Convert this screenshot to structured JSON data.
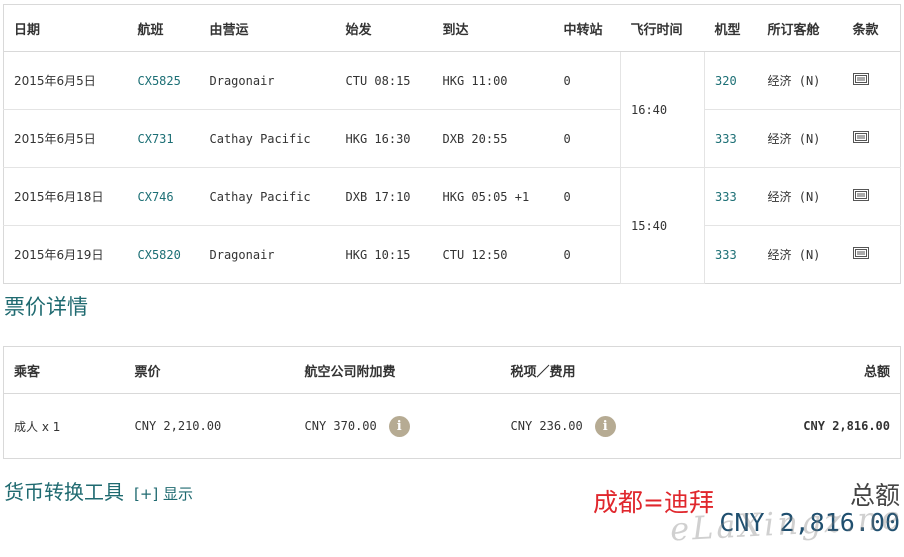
{
  "flights": {
    "headers": [
      "日期",
      "航班",
      "由营运",
      "始发",
      "到达",
      "中转站",
      "飞行时间",
      "机型",
      "所订客舱",
      "条款"
    ],
    "rows": [
      {
        "date": "2015年6月5日",
        "flight": "CX5825",
        "operator": "Dragonair",
        "depart": "CTU 08:15",
        "arrive": "HKG 11:00",
        "stops": "0",
        "aircraft": "320",
        "cabin": "经济 (N)"
      },
      {
        "date": "2015年6月5日",
        "flight": "CX731",
        "operator": "Cathay Pacific",
        "depart": "HKG 16:30",
        "arrive": "DXB 20:55",
        "stops": "0",
        "aircraft": "333",
        "cabin": "经济 (N)"
      },
      {
        "date": "2015年6月18日",
        "flight": "CX746",
        "operator": "Cathay Pacific",
        "depart": "DXB 17:10",
        "arrive": "HKG 05:05 +1",
        "stops": "0",
        "aircraft": "333",
        "cabin": "经济 (N)"
      },
      {
        "date": "2015年6月19日",
        "flight": "CX5820",
        "operator": "Dragonair",
        "depart": "HKG 10:15",
        "arrive": "CTU 12:50",
        "stops": "0",
        "aircraft": "333",
        "cabin": "经济 (N)"
      }
    ],
    "durations": [
      "16:40",
      "15:40"
    ],
    "terms_icon": "document-icon"
  },
  "fare_details": {
    "title": "票价详情",
    "headers": {
      "passenger": "乘客",
      "fare": "票价",
      "surcharge": "航空公司附加费",
      "taxes": "税项／费用",
      "total": "总额"
    },
    "row": {
      "passenger": "成人 x 1",
      "fare": "CNY 2,210.00",
      "surcharge": "CNY 370.00",
      "taxes": "CNY 236.00",
      "total": "CNY 2,816.00"
    },
    "info_icon": "i"
  },
  "converter": {
    "title": "货币转换工具",
    "toggle": "[+] 显示"
  },
  "route_note": "成都=迪拜",
  "grand_total": {
    "label": "总额",
    "value": "CNY 2,816.00"
  },
  "watermark": "eLaXingz.net",
  "colors": {
    "accent": "#1f6a70",
    "link": "#1c6f75",
    "note": "#e0272d",
    "info": "#b6ab93"
  }
}
